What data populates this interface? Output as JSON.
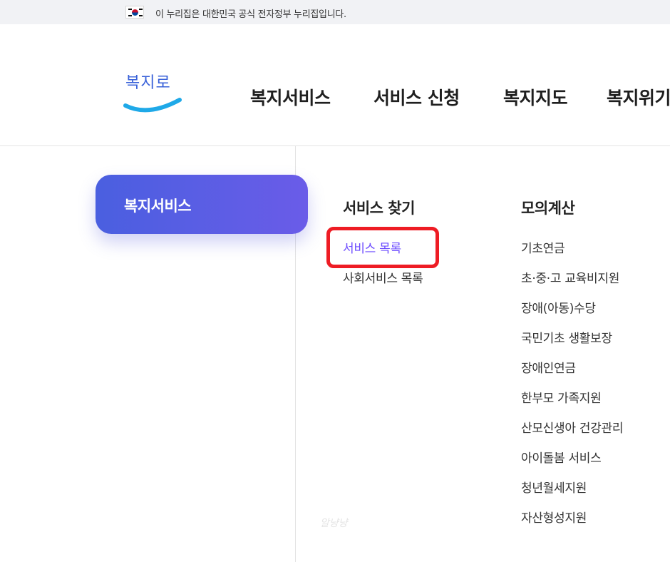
{
  "gov_banner": {
    "text": "이 누리집은 대한민국 공식 전자정부 누리집입니다."
  },
  "logo": {
    "text": "복지로"
  },
  "nav": {
    "items": [
      "복지서비스",
      "서비스 신청",
      "복지지도",
      "복지위기"
    ]
  },
  "side_menu": {
    "active_label": "복지서비스"
  },
  "columns": [
    {
      "title": "서비스 찾기",
      "links": [
        "서비스 목록",
        "사회서비스 목록"
      ],
      "active_index": 0
    },
    {
      "title": "모의계산",
      "links": [
        "기초연금",
        "초·중·고 교육비지원",
        "장애(아동)수당",
        "국민기초 생활보장",
        "장애인연금",
        "한부모 가족지원",
        "산모신생아 건강관리",
        "아이돌봄 서비스",
        "청년월세지원",
        "자산형성지원"
      ]
    }
  ],
  "watermark": "알냥냥",
  "colors": {
    "accent_purple": "#6d4cff",
    "pill_start": "#4a5fe0",
    "pill_end": "#6a5ce8",
    "highlight_red": "#ee1c24",
    "logo_blue": "#3a62d9"
  }
}
